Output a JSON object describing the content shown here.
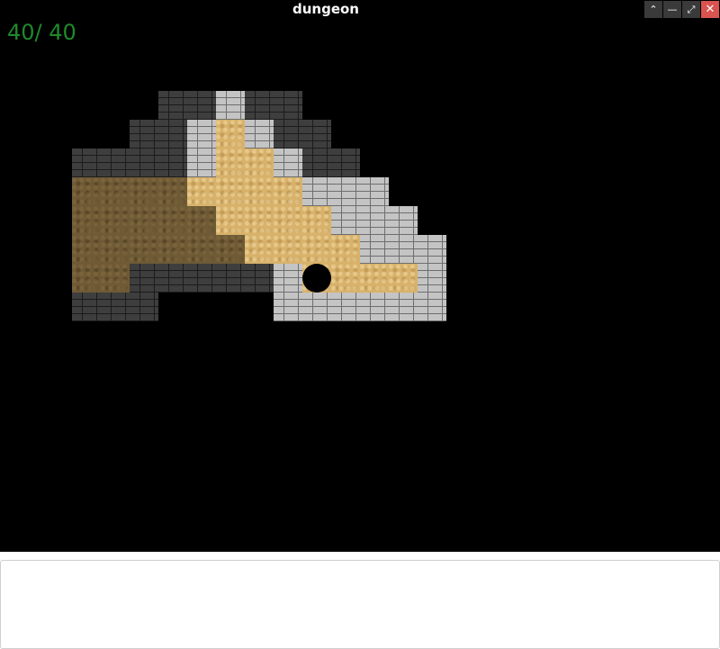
{
  "window": {
    "title": "dungeon",
    "buttons": {
      "maximize": "⌃",
      "minimize": "—",
      "restore": "⤢",
      "close": "✕"
    }
  },
  "hud": {
    "hp": "40/ 40"
  },
  "map": {
    "legend": {
      "D": "wall-dark",
      "L": "wall-light",
      "F": "floor-lit",
      "B": "floor-dark",
      "H": "hole"
    },
    "rows": [
      "......DDLDD.....",
      ".....DDLFLDD....",
      "...DDDDLFFLDD...",
      "...BBBBFFFFLLL..",
      "...BBBBBFFFFLLL.",
      "...BBBBBBFFFFLLL",
      "...BBDDDDDLHFFFL",
      "...DDD....LLLLLL"
    ],
    "colors": {
      "floor_lit": "#d8b26a",
      "floor_dark": "#6e5a35",
      "wall_light": "#c4c4c4",
      "wall_dark": "#3e3e3e",
      "hp_text": "#1f8a2a"
    }
  },
  "console": {
    "text": ""
  }
}
